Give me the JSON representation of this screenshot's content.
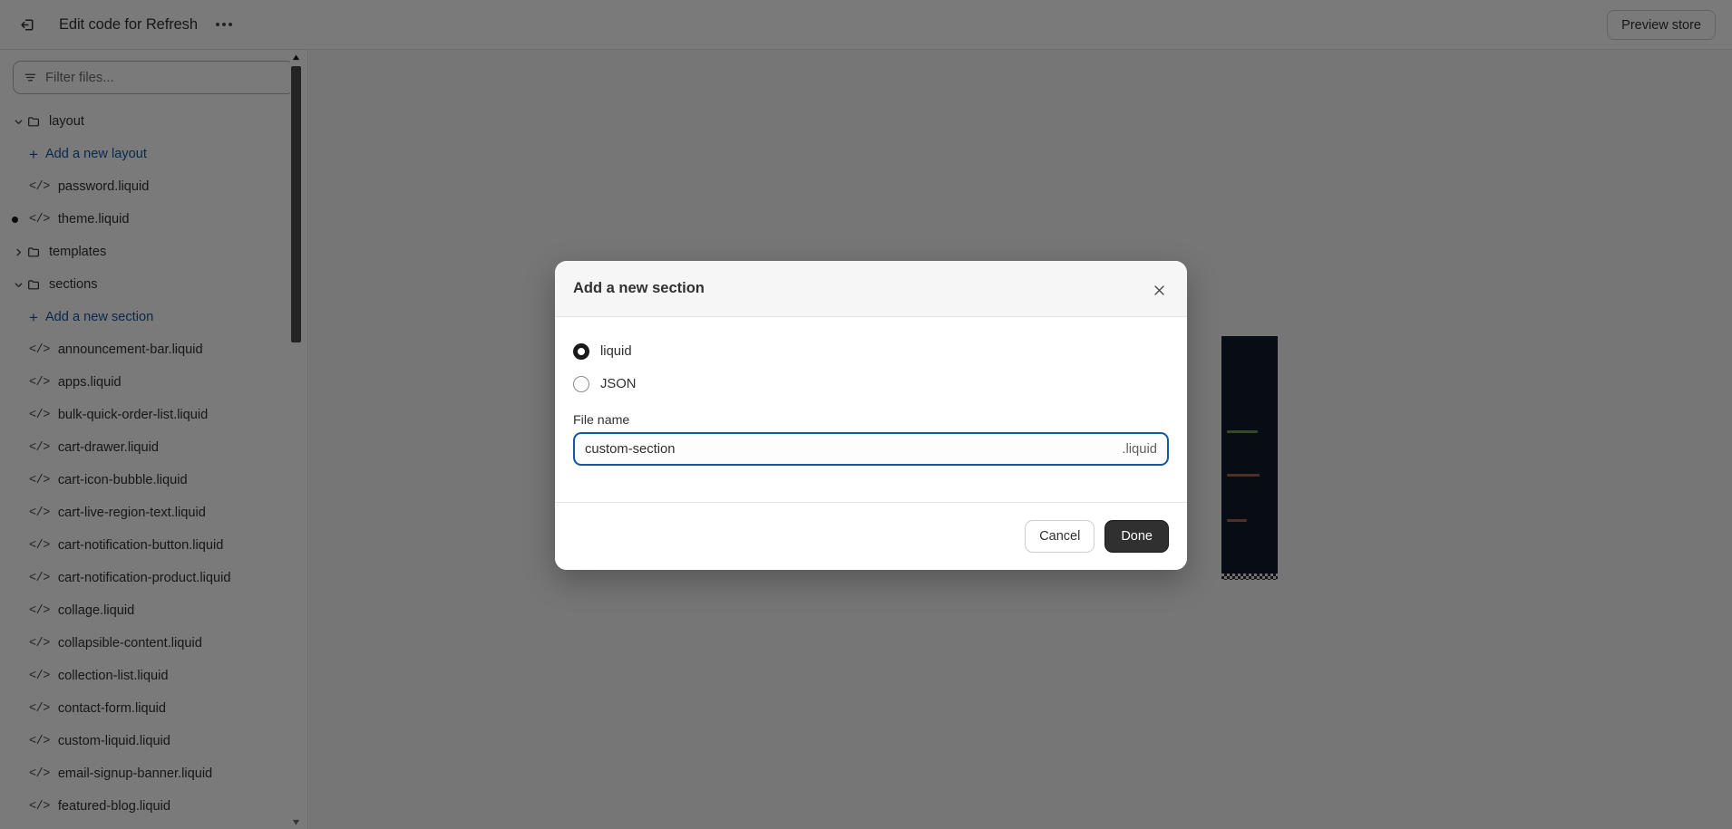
{
  "topbar": {
    "exit_icon": "exit-icon",
    "title": "Edit code for Refresh",
    "more_icon": "more-options-icon",
    "preview_label": "Preview store"
  },
  "sidebar": {
    "filter": {
      "placeholder": "Filter files...",
      "icon": "filter-icon",
      "value": ""
    },
    "tree": [
      {
        "type": "folder",
        "label": "layout",
        "expanded": true,
        "caret": "chevron-down-icon"
      },
      {
        "type": "add",
        "label": "Add a new layout",
        "icon": "plus-icon"
      },
      {
        "type": "file",
        "label": "password.liquid",
        "icon": "code-icon",
        "modified": false
      },
      {
        "type": "file",
        "label": "theme.liquid",
        "icon": "code-icon",
        "modified": true
      },
      {
        "type": "folder",
        "label": "templates",
        "expanded": false,
        "caret": "chevron-right-icon"
      },
      {
        "type": "folder",
        "label": "sections",
        "expanded": true,
        "caret": "chevron-down-icon"
      },
      {
        "type": "add",
        "label": "Add a new section",
        "icon": "plus-icon"
      },
      {
        "type": "file",
        "label": "announcement-bar.liquid",
        "icon": "code-icon",
        "modified": false
      },
      {
        "type": "file",
        "label": "apps.liquid",
        "icon": "code-icon",
        "modified": false
      },
      {
        "type": "file",
        "label": "bulk-quick-order-list.liquid",
        "icon": "code-icon",
        "modified": false
      },
      {
        "type": "file",
        "label": "cart-drawer.liquid",
        "icon": "code-icon",
        "modified": false
      },
      {
        "type": "file",
        "label": "cart-icon-bubble.liquid",
        "icon": "code-icon",
        "modified": false
      },
      {
        "type": "file",
        "label": "cart-live-region-text.liquid",
        "icon": "code-icon",
        "modified": false
      },
      {
        "type": "file",
        "label": "cart-notification-button.liquid",
        "icon": "code-icon",
        "modified": false
      },
      {
        "type": "file",
        "label": "cart-notification-product.liquid",
        "icon": "code-icon",
        "modified": false
      },
      {
        "type": "file",
        "label": "collage.liquid",
        "icon": "code-icon",
        "modified": false
      },
      {
        "type": "file",
        "label": "collapsible-content.liquid",
        "icon": "code-icon",
        "modified": false
      },
      {
        "type": "file",
        "label": "collection-list.liquid",
        "icon": "code-icon",
        "modified": false
      },
      {
        "type": "file",
        "label": "contact-form.liquid",
        "icon": "code-icon",
        "modified": false
      },
      {
        "type": "file",
        "label": "custom-liquid.liquid",
        "icon": "code-icon",
        "modified": false
      },
      {
        "type": "file",
        "label": "email-signup-banner.liquid",
        "icon": "code-icon",
        "modified": false
      },
      {
        "type": "file",
        "label": "featured-blog.liquid",
        "icon": "code-icon",
        "modified": false
      }
    ],
    "scrollbar": {
      "up_icon": "scroll-up-arrow-icon",
      "down_icon": "scroll-down-arrow-icon"
    }
  },
  "modal": {
    "title": "Add a new section",
    "close_icon": "close-icon",
    "options": [
      {
        "label": "liquid",
        "selected": true
      },
      {
        "label": "JSON",
        "selected": false
      }
    ],
    "file_name_label": "File name",
    "file_name_value": "custom-section",
    "file_name_suffix": ".liquid",
    "file_name_placeholder": "",
    "cancel_label": "Cancel",
    "done_label": "Done"
  },
  "colors": {
    "accent_link": "#1456a0",
    "focus_ring": "#1456a0",
    "primary_button": "#303030",
    "text": "#303030"
  }
}
